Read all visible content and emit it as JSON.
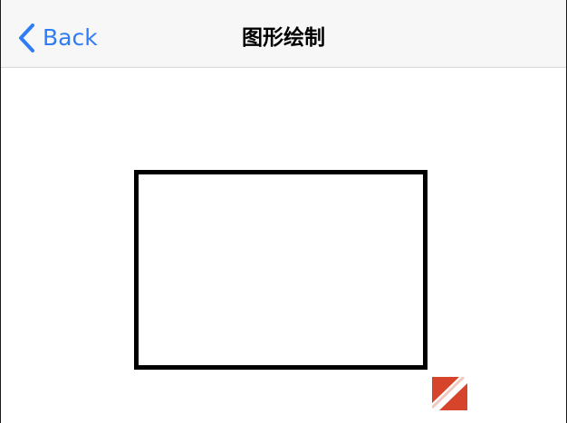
{
  "nav": {
    "back_label": "Back",
    "title": "图形绘制"
  },
  "colors": {
    "accent": "#2f7df6",
    "nav_background": "#f7f7f7",
    "rect_stroke": "#000000",
    "mark_red": "#d6442b"
  },
  "icons": {
    "back": "chevron-left-icon",
    "mark": "red-diagonal-square-icon"
  }
}
